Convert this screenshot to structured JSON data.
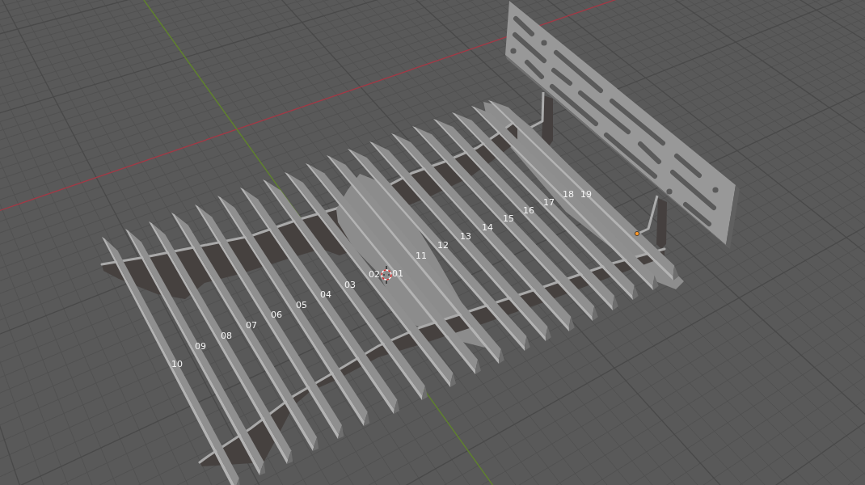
{
  "viewport": {
    "vertex_labels": [
      "01",
      "02",
      "03",
      "04",
      "05",
      "06",
      "07",
      "08",
      "09",
      "10",
      "11",
      "12",
      "13",
      "14",
      "15",
      "16",
      "17",
      "18",
      "19"
    ]
  }
}
